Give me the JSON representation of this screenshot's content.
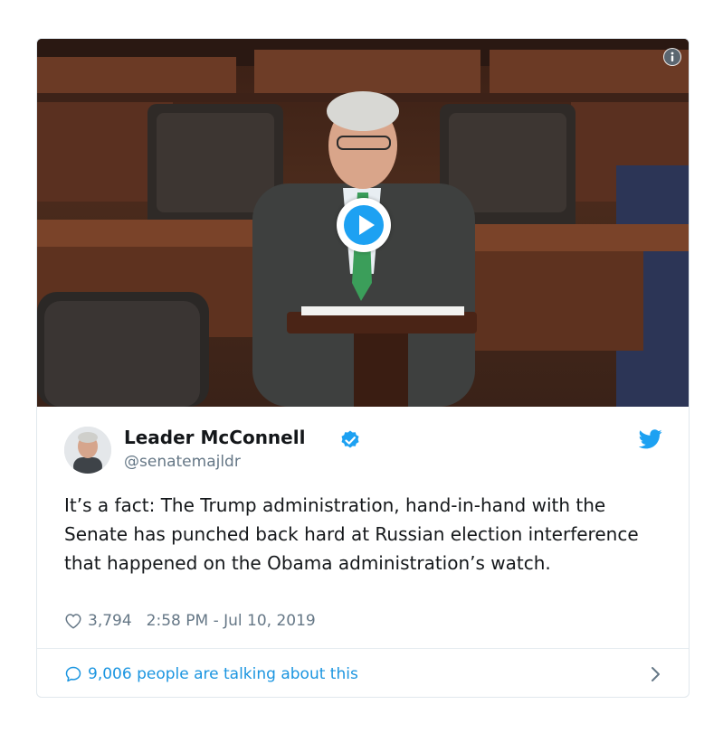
{
  "tweet": {
    "author_name": "Leader McConnell",
    "handle": "@senatemajldr",
    "text": "It’s a fact: The Trump administration, hand-in-hand with the Senate has punched back hard at Russian election interference that happened on the Obama administration’s watch.",
    "likes": "3,794",
    "timestamp": "2:58 PM - Jul 10, 2019",
    "conversation": "9,006 people are talking about this"
  },
  "icons": {
    "info": "info-icon",
    "play": "play-icon",
    "verified": "verified-badge-icon",
    "brand": "twitter-bird-icon",
    "like": "heart-icon",
    "reply": "speech-bubble-icon",
    "more": "chevron-right-icon"
  },
  "colors": {
    "brand_blue": "#1da1f2",
    "link_blue": "#1b95e0",
    "text": "#14171a",
    "muted": "#657786",
    "border": "#e1e8ed"
  }
}
